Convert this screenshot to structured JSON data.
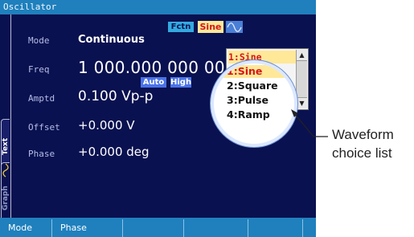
{
  "window": {
    "title": "Oscillator"
  },
  "side_tabs": [
    {
      "label": "Text"
    },
    {
      "label": "Graph"
    }
  ],
  "params": {
    "mode": {
      "label": "Mode",
      "value": "Continuous"
    },
    "freq": {
      "label": "Freq",
      "value": "1 000.000 000 00"
    },
    "amptd": {
      "label": "Amptd",
      "value": "0.100 Vp-p"
    },
    "offset": {
      "label": "Offset",
      "value": "+0.000 V"
    },
    "phase": {
      "label": "Phase",
      "value": "+0.000 deg"
    }
  },
  "chips": {
    "fctn": "Fctn",
    "sine": "Sine",
    "auto": "Auto",
    "high": "High"
  },
  "waveform_list": {
    "options": [
      "1:Sine",
      "2:Square",
      "3:Pulse",
      "4:Ramp"
    ],
    "selected": "1:Sine"
  },
  "softkeys": [
    "Mode",
    "Phase",
    "",
    "",
    "",
    ""
  ],
  "callout": {
    "line1": "Waveform",
    "line2": "choice list"
  },
  "colors": {
    "background": "#0a1150",
    "bar": "#1f80bd",
    "highlight": "#ffe898",
    "accent_red": "#d4161b",
    "chip_blue": "#4b73e8"
  }
}
